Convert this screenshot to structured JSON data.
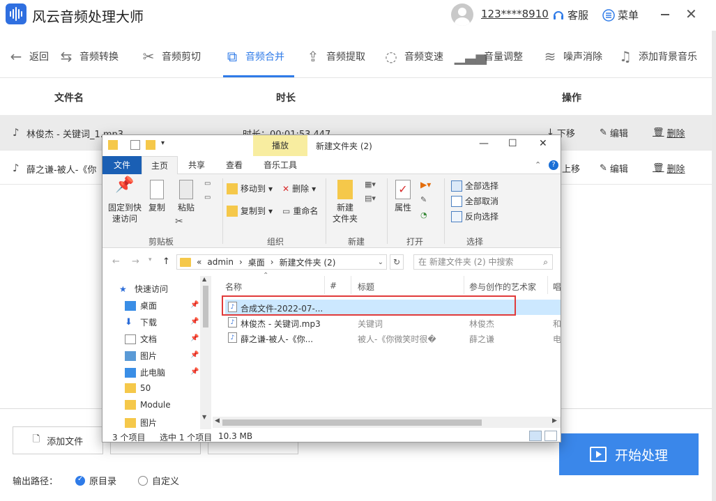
{
  "app": {
    "title": "风云音频处理大师",
    "user_phone": "123****8910",
    "service_label": "客服",
    "menu_label": "菜单"
  },
  "toolbar": {
    "back": "返回",
    "items": [
      "音频转换",
      "音频剪切",
      "音频合并",
      "音频提取",
      "音频变速",
      "音量调整",
      "噪声消除",
      "添加背景音乐"
    ],
    "active": "音频合并"
  },
  "table": {
    "headers": {
      "name": "文件名",
      "duration": "时长",
      "actions": "操作"
    },
    "rows": [
      {
        "name": "林俊杰 - 关键词_1.mp3",
        "duration": "时长：00:01:53.447",
        "move": "下移",
        "edit": "编辑",
        "delete": "删除"
      },
      {
        "name": "薛之谦-被人-《你",
        "duration": "",
        "move": "上移",
        "edit": "编辑",
        "delete": "删除"
      }
    ]
  },
  "bottom": {
    "add_file": "添加文件",
    "start": "开始处理",
    "output_label": "输出路径：",
    "radio_original": "原目录",
    "radio_custom": "自定义"
  },
  "explorer": {
    "title": "新建文件夹 (2)",
    "context_tab": "播放",
    "tabs": [
      "文件",
      "主页",
      "共享",
      "查看",
      "音乐工具"
    ],
    "ribbon": {
      "pin": [
        "固定到快",
        "速访问"
      ],
      "copy": "复制",
      "paste": "粘贴",
      "clipboard": "剪贴板",
      "move_to": "移动到",
      "copy_to": "复制到",
      "delete": "删除",
      "rename": "重命名",
      "organize": "组织",
      "new_folder": [
        "新建",
        "文件夹"
      ],
      "new_group": "新建",
      "properties": "属性",
      "open_group": "打开",
      "select_all": "全部选择",
      "select_none": "全部取消",
      "invert": "反向选择",
      "select_group": "选择"
    },
    "address": {
      "crumbs": [
        "«",
        "admin",
        "›",
        "桌面",
        "›",
        "新建文件夹 (2)"
      ],
      "search_placeholder": "在 新建文件夹 (2) 中搜索"
    },
    "nav": [
      {
        "label": "快速访问",
        "icon": "star-icon",
        "pinned": false
      },
      {
        "label": "桌面",
        "icon": "desktop-icon",
        "pinned": true
      },
      {
        "label": "下载",
        "icon": "download-icon",
        "pinned": true
      },
      {
        "label": "文档",
        "icon": "document-icon",
        "pinned": true
      },
      {
        "label": "图片",
        "icon": "picture-icon",
        "pinned": true
      },
      {
        "label": "此电脑",
        "icon": "computer-icon",
        "pinned": true
      },
      {
        "label": "50",
        "icon": "folder-icon",
        "pinned": false
      },
      {
        "label": "Module",
        "icon": "folder-icon",
        "pinned": false
      },
      {
        "label": "图片",
        "icon": "folder-icon",
        "pinned": false
      }
    ],
    "columns": [
      "名称",
      "#",
      "标题",
      "参与创作的艺术家",
      "唱"
    ],
    "files": [
      {
        "name": "合成文件-2022-07-...",
        "num": "",
        "title": "",
        "artist": "",
        "extra": ""
      },
      {
        "name": "林俊杰 - 关键词.mp3",
        "num": "",
        "title": "关键词",
        "artist": "林俊杰",
        "extra": "和"
      },
      {
        "name": "薛之谦-被人-《你...",
        "num": "",
        "title": "被人-《你微笑时很�",
        "artist": "薛之谦",
        "extra": "电"
      }
    ],
    "status": {
      "count": "3 个项目",
      "selected": "选中 1 个项目",
      "size": "10.3 MB"
    }
  },
  "colors": {
    "accent": "#2f7be8",
    "start_button": "#3a87ea",
    "highlight": "#e03a3a",
    "file_tab": "#1a5fb4",
    "context_tab": "#f8eda0"
  }
}
